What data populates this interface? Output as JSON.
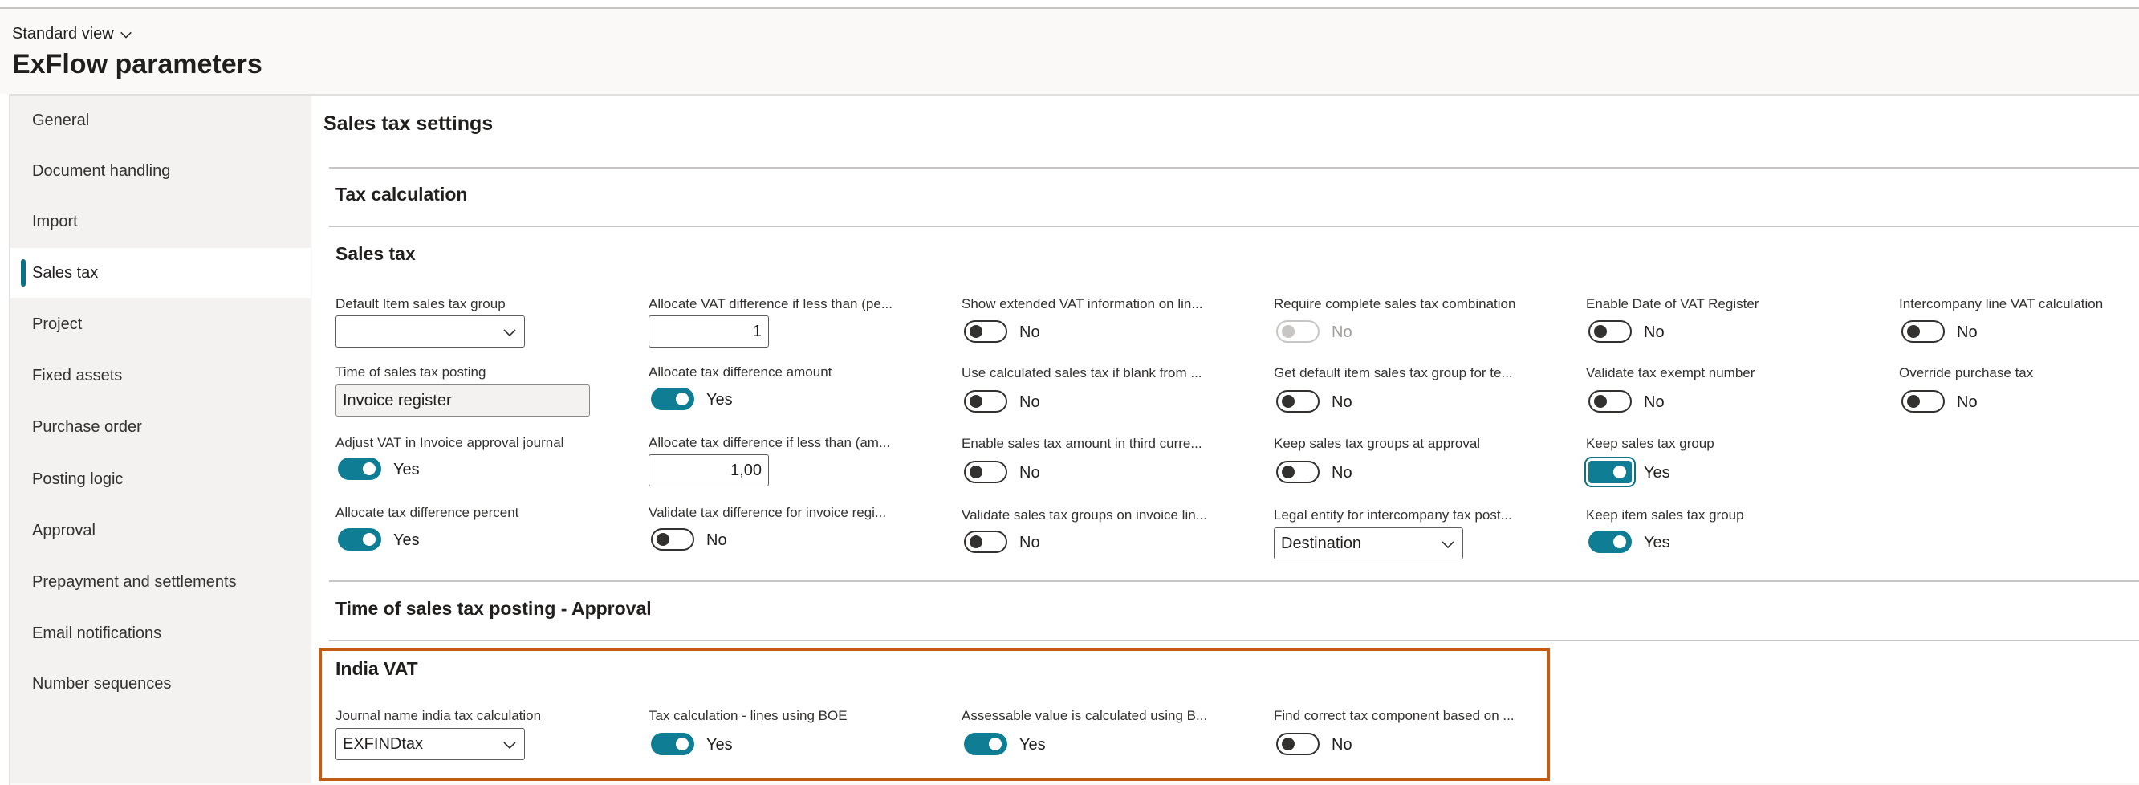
{
  "header": {
    "view_label": "Standard view",
    "page_title": "ExFlow parameters"
  },
  "nav": {
    "items": [
      {
        "label": "General"
      },
      {
        "label": "Document handling"
      },
      {
        "label": "Import"
      },
      {
        "label": "Sales tax"
      },
      {
        "label": "Project"
      },
      {
        "label": "Fixed assets"
      },
      {
        "label": "Purchase order"
      },
      {
        "label": "Posting logic"
      },
      {
        "label": "Approval"
      },
      {
        "label": "Prepayment and settlements"
      },
      {
        "label": "Email notifications"
      },
      {
        "label": "Number sequences"
      }
    ],
    "active": "Sales tax"
  },
  "main": {
    "section_title": "Sales tax settings",
    "groups": {
      "tax_calculation": "Tax calculation",
      "sales_tax": "Sales tax",
      "time_approval": "Time of sales tax posting - Approval",
      "india_vat": "India VAT"
    },
    "sales_tax": {
      "default_item_group": {
        "label": "Default Item sales tax group",
        "value": ""
      },
      "time_posting": {
        "label": "Time of sales tax posting",
        "value": "Invoice register"
      },
      "adjust_vat": {
        "label": "Adjust VAT in Invoice approval journal",
        "state": "Yes"
      },
      "alloc_percent": {
        "label": "Allocate tax difference percent",
        "state": "Yes"
      },
      "alloc_vat_diff": {
        "label": "Allocate VAT difference if less than (pe...",
        "value": "1"
      },
      "alloc_amount": {
        "label": "Allocate tax difference amount",
        "state": "Yes"
      },
      "alloc_less_amount": {
        "label": "Allocate tax difference if less than (am...",
        "value": "1,00"
      },
      "validate_diff_reg": {
        "label": "Validate tax difference for invoice regi...",
        "state": "No"
      },
      "show_extended": {
        "label": "Show extended VAT information on lin...",
        "state": "No"
      },
      "use_calculated": {
        "label": "Use calculated sales tax if blank from ...",
        "state": "No"
      },
      "enable_third_curr": {
        "label": "Enable sales tax amount in third curre...",
        "state": "No"
      },
      "validate_groups_inv": {
        "label": "Validate sales tax groups on invoice lin...",
        "state": "No"
      },
      "require_complete": {
        "label": "Require complete sales tax combination",
        "state": "No"
      },
      "get_default_item": {
        "label": "Get default item sales tax group for te...",
        "state": "No"
      },
      "keep_at_approval": {
        "label": "Keep sales tax groups at approval",
        "state": "No"
      },
      "legal_entity": {
        "label": "Legal entity for intercompany tax post...",
        "value": "Destination"
      },
      "enable_date_vat": {
        "label": "Enable Date of VAT Register",
        "state": "No"
      },
      "validate_exempt": {
        "label": "Validate tax exempt number",
        "state": "No"
      },
      "keep_sales_group": {
        "label": "Keep sales tax group",
        "state": "Yes"
      },
      "keep_item_group": {
        "label": "Keep item sales tax group",
        "state": "Yes"
      },
      "intercompany_vat": {
        "label": "Intercompany line VAT calculation",
        "state": "No"
      },
      "override_purchase": {
        "label": "Override purchase tax",
        "state": "No"
      }
    },
    "india_vat": {
      "journal_name": {
        "label": "Journal name india tax calculation",
        "value": "EXFINDtax"
      },
      "tax_calc_boe": {
        "label": "Tax calculation - lines using BOE",
        "state": "Yes"
      },
      "assessable_value": {
        "label": "Assessable value is calculated using B...",
        "state": "Yes"
      },
      "find_component": {
        "label": "Find correct tax component based on ...",
        "state": "No"
      }
    }
  },
  "colors": {
    "accent": "#0f7e95",
    "highlight_box": "#c55a11"
  }
}
